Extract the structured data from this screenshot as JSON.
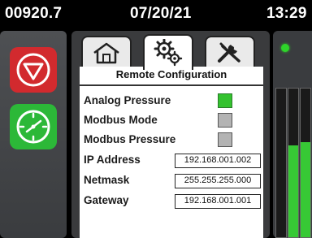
{
  "status": {
    "value": "00920.7",
    "date": "07/20/21",
    "time": "13:29"
  },
  "left_buttons": [
    {
      "name": "stop",
      "icon": "stop-icon",
      "color": "#d7282c"
    },
    {
      "name": "gauge",
      "icon": "gauge-icon",
      "color": "#2fbf3a"
    }
  ],
  "tabs": [
    {
      "icon": "home-icon",
      "active": false
    },
    {
      "icon": "gear-icon",
      "active": true
    },
    {
      "icon": "tools-icon",
      "active": false
    }
  ],
  "panel": {
    "title": "Remote Configuration",
    "options": [
      {
        "label": "Analog Pressure",
        "checked": true
      },
      {
        "label": "Modbus Mode",
        "checked": false
      },
      {
        "label": "Modbus Pressure",
        "checked": false
      }
    ],
    "fields": [
      {
        "label": "IP Address",
        "value": "192.168.001.002"
      },
      {
        "label": "Netmask",
        "value": "255.255.255.000"
      },
      {
        "label": "Gateway",
        "value": "192.168.001.001"
      }
    ]
  },
  "right": {
    "indicator_color": "#2ed42a",
    "bars": [
      {
        "level": 0.0
      },
      {
        "level": 0.62
      },
      {
        "level": 0.64
      }
    ]
  }
}
